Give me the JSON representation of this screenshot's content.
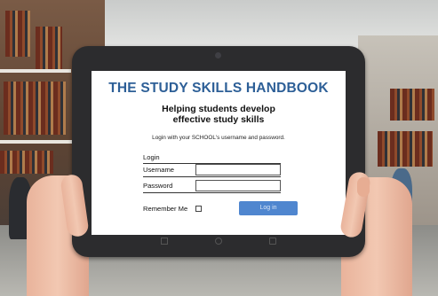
{
  "app": {
    "title": "THE STUDY SKILLS HANDBOOK",
    "subtitle_line1": "Helping students develop",
    "subtitle_line2": "effective study skills",
    "instruction": "Login with your SCHOOL's username and password."
  },
  "login_form": {
    "heading": "Login",
    "username_label": "Username",
    "username_value": "",
    "password_label": "Password",
    "password_value": "",
    "remember_label": "Remember Me",
    "remember_checked": false,
    "submit_label": "Log in"
  },
  "colors": {
    "title": "#2d5f97",
    "button": "#4f86cf",
    "tablet_bezel": "#2c2c2e"
  }
}
